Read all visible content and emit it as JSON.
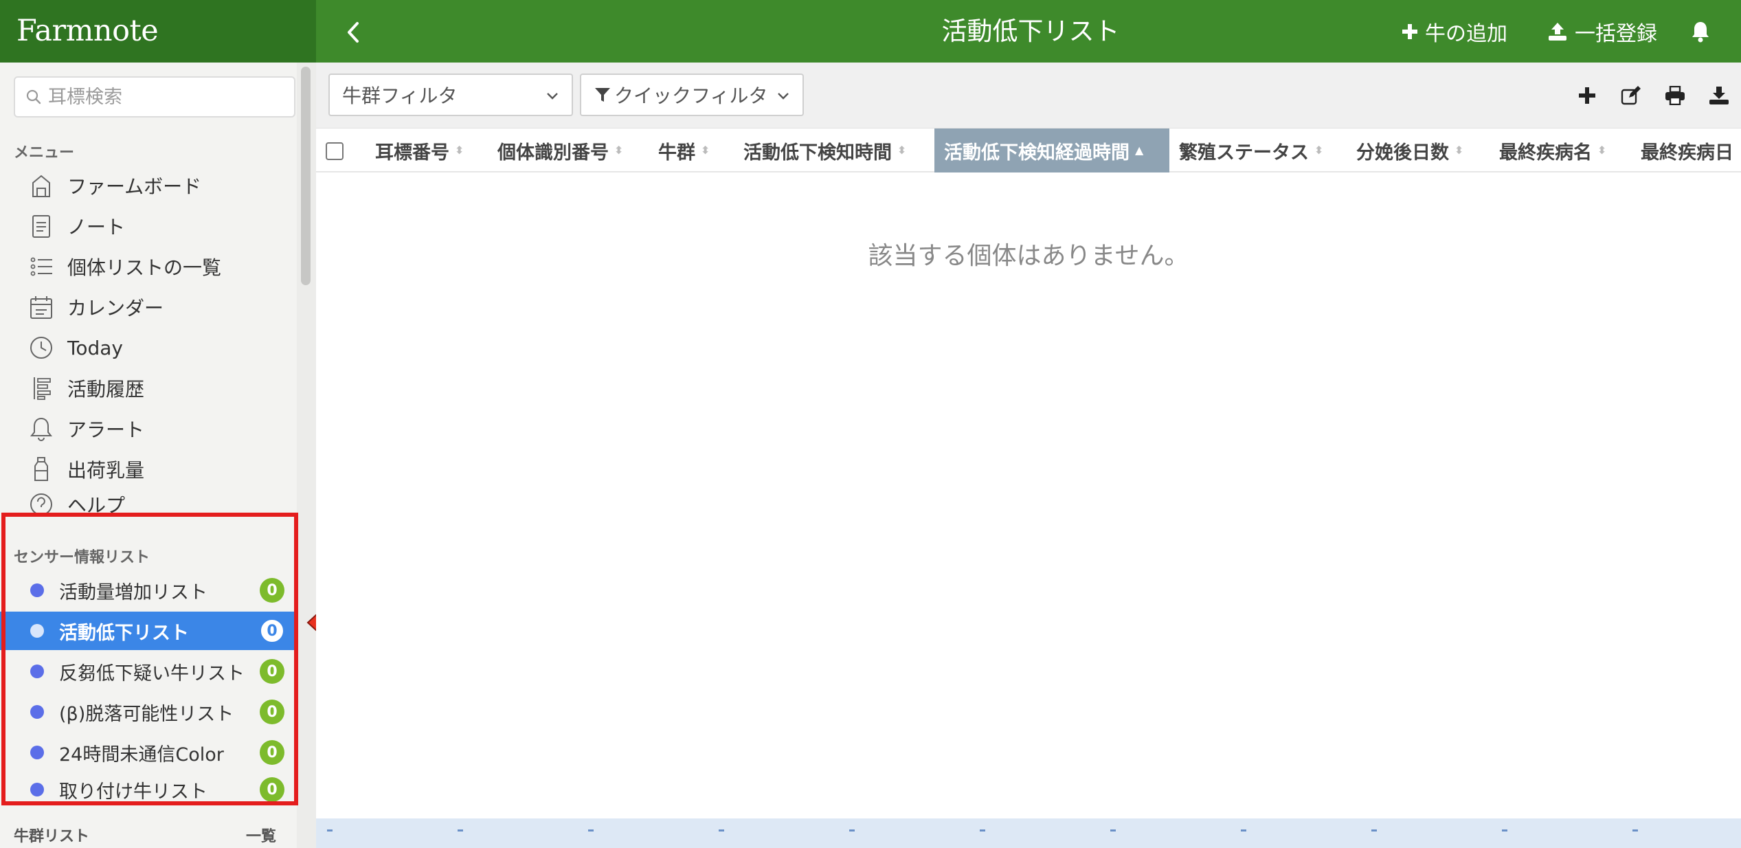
{
  "app": {
    "brand": "Farmnote",
    "title": "活動低下リスト",
    "add_cow": "牛の追加",
    "bulk_register": "一括登録"
  },
  "sidebar": {
    "search_placeholder": "耳標検索",
    "menu_heading": "メニュー",
    "menu": [
      {
        "label": "ファームボード",
        "icon": "farm-board-icon"
      },
      {
        "label": "ノート",
        "icon": "note-icon"
      },
      {
        "label": "個体リストの一覧",
        "icon": "list-icon"
      },
      {
        "label": "カレンダー",
        "icon": "calendar-icon"
      },
      {
        "label": "Today",
        "icon": "clock-icon"
      },
      {
        "label": "活動履歴",
        "icon": "activity-history-icon"
      },
      {
        "label": "アラート",
        "icon": "bell-icon"
      },
      {
        "label": "出荷乳量",
        "icon": "milk-bottle-icon"
      },
      {
        "label": "ヘルプ",
        "icon": "help-icon"
      }
    ],
    "sensor_heading": "センサー情報リスト",
    "sensor_lists": [
      {
        "label": "活動量増加リスト",
        "count": "0",
        "active": false
      },
      {
        "label": "活動低下リスト",
        "count": "0",
        "active": true
      },
      {
        "label": "反芻低下疑い牛リスト",
        "count": "0",
        "active": false
      },
      {
        "label": "(β)脱落可能性リスト",
        "count": "0",
        "active": false
      },
      {
        "label": "24時間未通信Color",
        "count": "0",
        "active": false
      },
      {
        "label": "取り付け牛リスト",
        "count": "0",
        "active": false
      }
    ],
    "herd_heading": "牛群リスト",
    "herd_link": "一覧"
  },
  "filters": {
    "herd_filter": "牛群フィルタ",
    "quick_filter": "クイックフィルタ"
  },
  "table": {
    "columns": [
      "耳標番号",
      "個体識別番号",
      "牛群",
      "活動低下検知時間",
      "活動低下検知経過時間",
      "繁殖ステータス",
      "分娩後日数",
      "最終疾病名",
      "最終疾病日"
    ],
    "sorted_column": "活動低下検知経過時間",
    "empty_message": "該当する個体はありません。"
  },
  "colors": {
    "header_green": "#3e8a2b",
    "brand_green": "#2f7421",
    "active_blue": "#3b86e7",
    "badge_green": "#7dbb2c",
    "highlight_red": "#e41d1d"
  }
}
